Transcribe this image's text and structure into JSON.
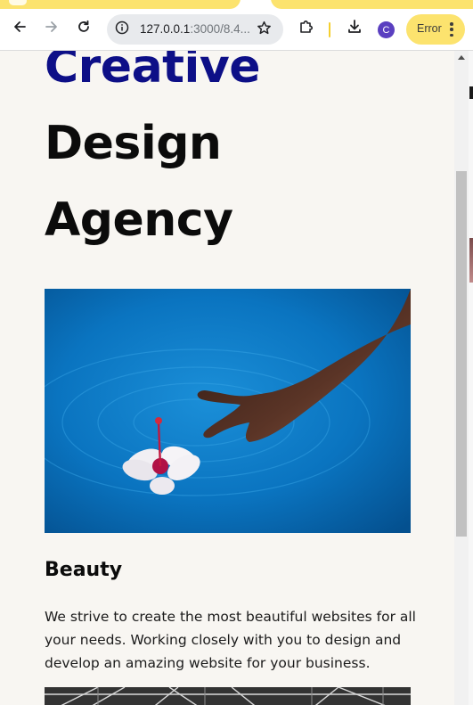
{
  "browser": {
    "url_host": "127.0.0.1",
    "url_rest": ":3000/8.4...",
    "profile_initial": "C",
    "error_chip_label": "Error"
  },
  "page": {
    "headline_accent": "Creative",
    "headline_line2": "Design",
    "headline_line3": "Agency",
    "section_title": "Beauty",
    "section_body": "We strive to create the most beautiful websites for all your needs. Working closely with you to design and develop an amazing website for your business."
  },
  "colors": {
    "accent": "#0d0f87",
    "page_background": "#f8f6f2",
    "chip_yellow": "#fce36e"
  },
  "icons": {
    "back": "arrow-left-icon",
    "forward": "arrow-right-icon",
    "reload": "reload-icon",
    "site_info": "info-icon",
    "bookmark": "star-icon",
    "extensions": "puzzle-icon",
    "downloads": "download-icon",
    "menu": "kebab-icon"
  }
}
